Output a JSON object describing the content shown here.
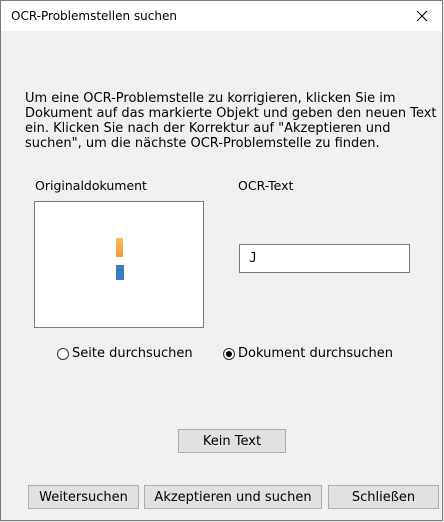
{
  "window": {
    "title": "OCR-Problemstellen suchen",
    "close_icon": "close-icon"
  },
  "instructions": "Um eine OCR-Problemstelle zu korrigieren, klicken Sie im Dokument auf das markierte Objekt und geben den neuen Text ein. Klicken Sie nach der Korrektur auf \"Akzeptieren und suchen\", um die nächste OCR-Problemstelle zu finden.",
  "original": {
    "label": "Originaldokument"
  },
  "ocr": {
    "label": "OCR-Text",
    "value": "J"
  },
  "search_scope": {
    "options": [
      {
        "label": "Seite durchsuchen",
        "checked": false
      },
      {
        "label": "Dokument durchsuchen",
        "checked": true
      }
    ]
  },
  "buttons": {
    "no_text": "Kein Text",
    "find_next": "Weitersuchen",
    "accept_find": "Akzeptieren und suchen",
    "close": "Schließen"
  }
}
